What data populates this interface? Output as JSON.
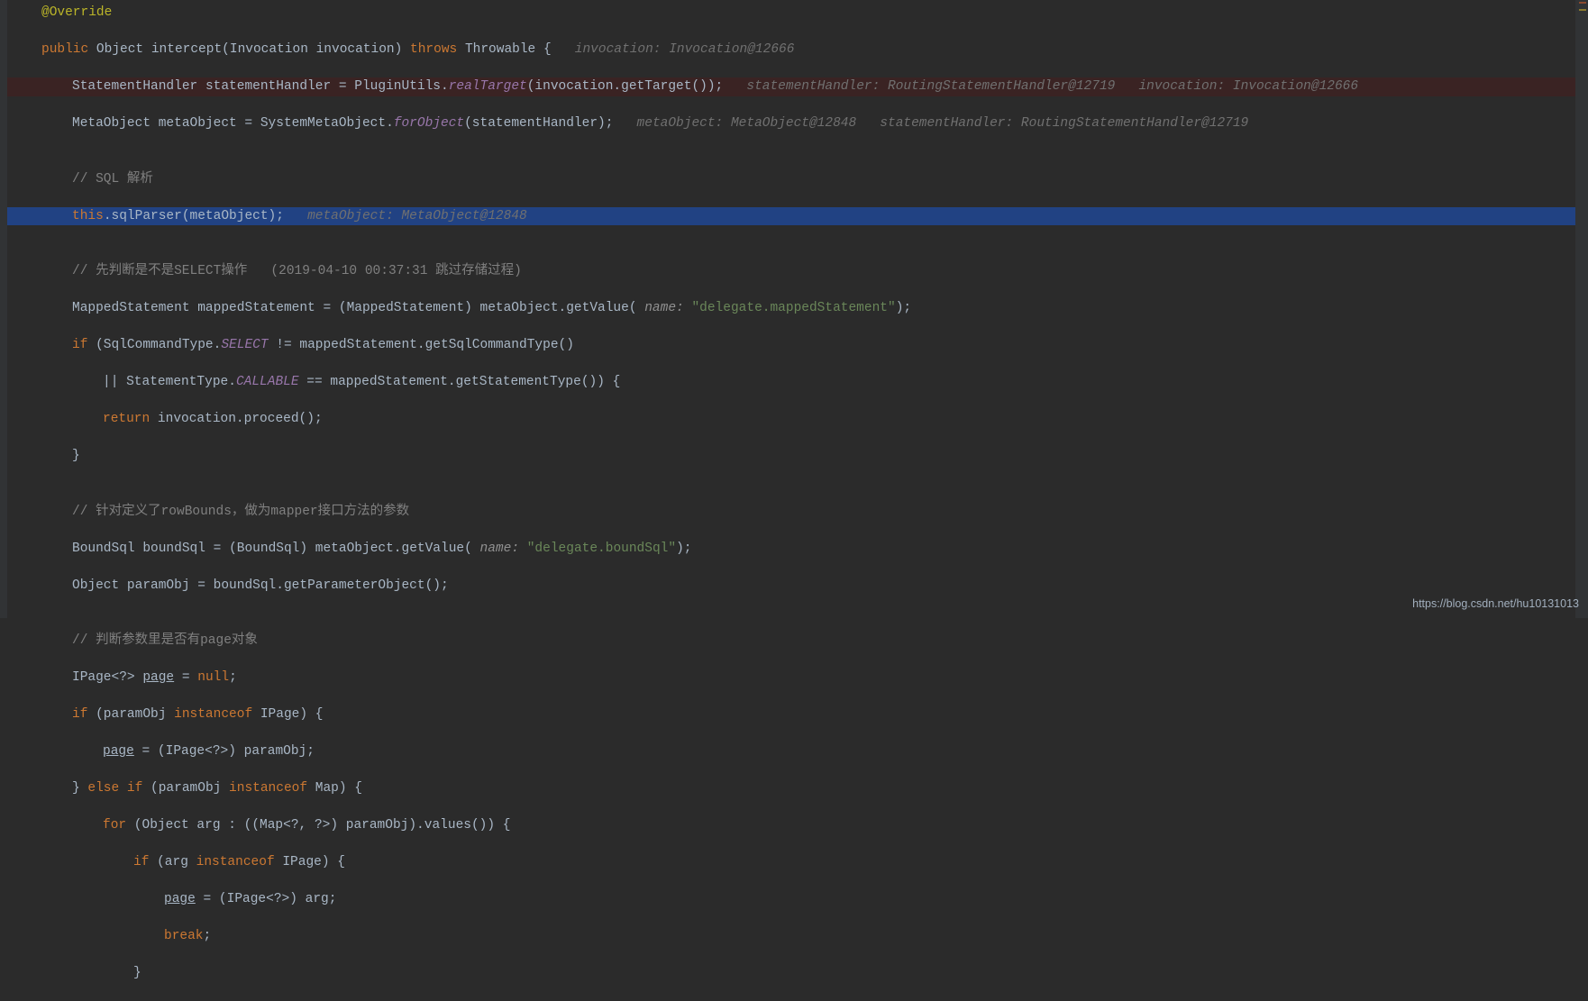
{
  "watermark": "https://blog.csdn.net/hu10131013",
  "tok": {
    "override": "@Override",
    "public": "public",
    "object": "Object",
    "intercept": "intercept",
    "invocation_type": "Invocation",
    "invocation_var": "invocation",
    "throws": "throws",
    "throwable": "Throwable",
    "brace_open": "{",
    "brace_close": "}",
    "hint_inv": "invocation: Invocation@12666",
    "sh_type": "StatementHandler",
    "sh_var": "statementHandler",
    "eq": " = ",
    "pluginUtils": "PluginUtils.",
    "realTarget": "realTarget",
    "realTarget_args": "(invocation.getTarget());",
    "hint_sh": "statementHandler: RoutingStatementHandler@12719   invocation: Invocation@12666",
    "mo_type": "MetaObject",
    "mo_var": "metaObject",
    "smo": "SystemMetaObject.",
    "forObject": "forObject",
    "forObject_args": "(statementHandler);",
    "hint_mo": "metaObject: MetaObject@12848   statementHandler: RoutingStatementHandler@12719",
    "c_sql": "// SQL 解析",
    "this": "this",
    "sqlParser": ".sqlParser(metaObject);",
    "hint_mo2": "metaObject: MetaObject@12848",
    "c_select": "// 先判断是不是SELECT操作   (2019-04-10 00:37:31 跳过存储过程)",
    "ms_type": "MappedStatement",
    "ms_var": "mappedStatement",
    "cast_ms": "(MappedStatement) metaObject.getValue(",
    "name_hint1": " name: ",
    "str_ms": "\"delegate.mappedStatement\"",
    "paren_close_semi": ");",
    "if": "if",
    "sct": "(SqlCommandType.",
    "SELECT": "SELECT",
    "neq_ms": " != mappedStatement.getSqlCommandType()",
    "or": "|| ",
    "stt": "StatementType.",
    "CALLABLE": "CALLABLE",
    "eq_ms_st": " == mappedStatement.getStatementType()) {",
    "return": "return",
    "inv_proceed": " invocation.proceed();",
    "c_row": "// 针对定义了rowBounds，做为mapper接口方法的参数",
    "bs_type": "BoundSql",
    "bs_var": "boundSql",
    "cast_bs": "(BoundSql) metaObject.getValue(",
    "str_bs": "\"delegate.boundSql\"",
    "obj": "Object",
    "paramObj": "paramObj",
    "bs_get": " = boundSql.getParameterObject();",
    "c_page": "// 判断参数里是否有page对象",
    "ipage_g": "IPage<?> ",
    "page_u": "page",
    "eq_null": " = ",
    "null": "null",
    "semi": ";",
    "if_paramObj": " (paramObj ",
    "instanceof": "instanceof",
    "ipage": " IPage) {",
    "cast_page": " = (IPage<?>) paramObj;",
    "else_if": " else if ",
    "map": " Map) {",
    "for": "for",
    "for_args": " (Object arg : ((Map<?, ?>) paramObj).values()) {",
    "if_arg": " (arg ",
    "ipage2": " IPage) {",
    "cast_arg": " = (IPage<?>) arg;",
    "break": "break",
    "only_brace": "}"
  }
}
